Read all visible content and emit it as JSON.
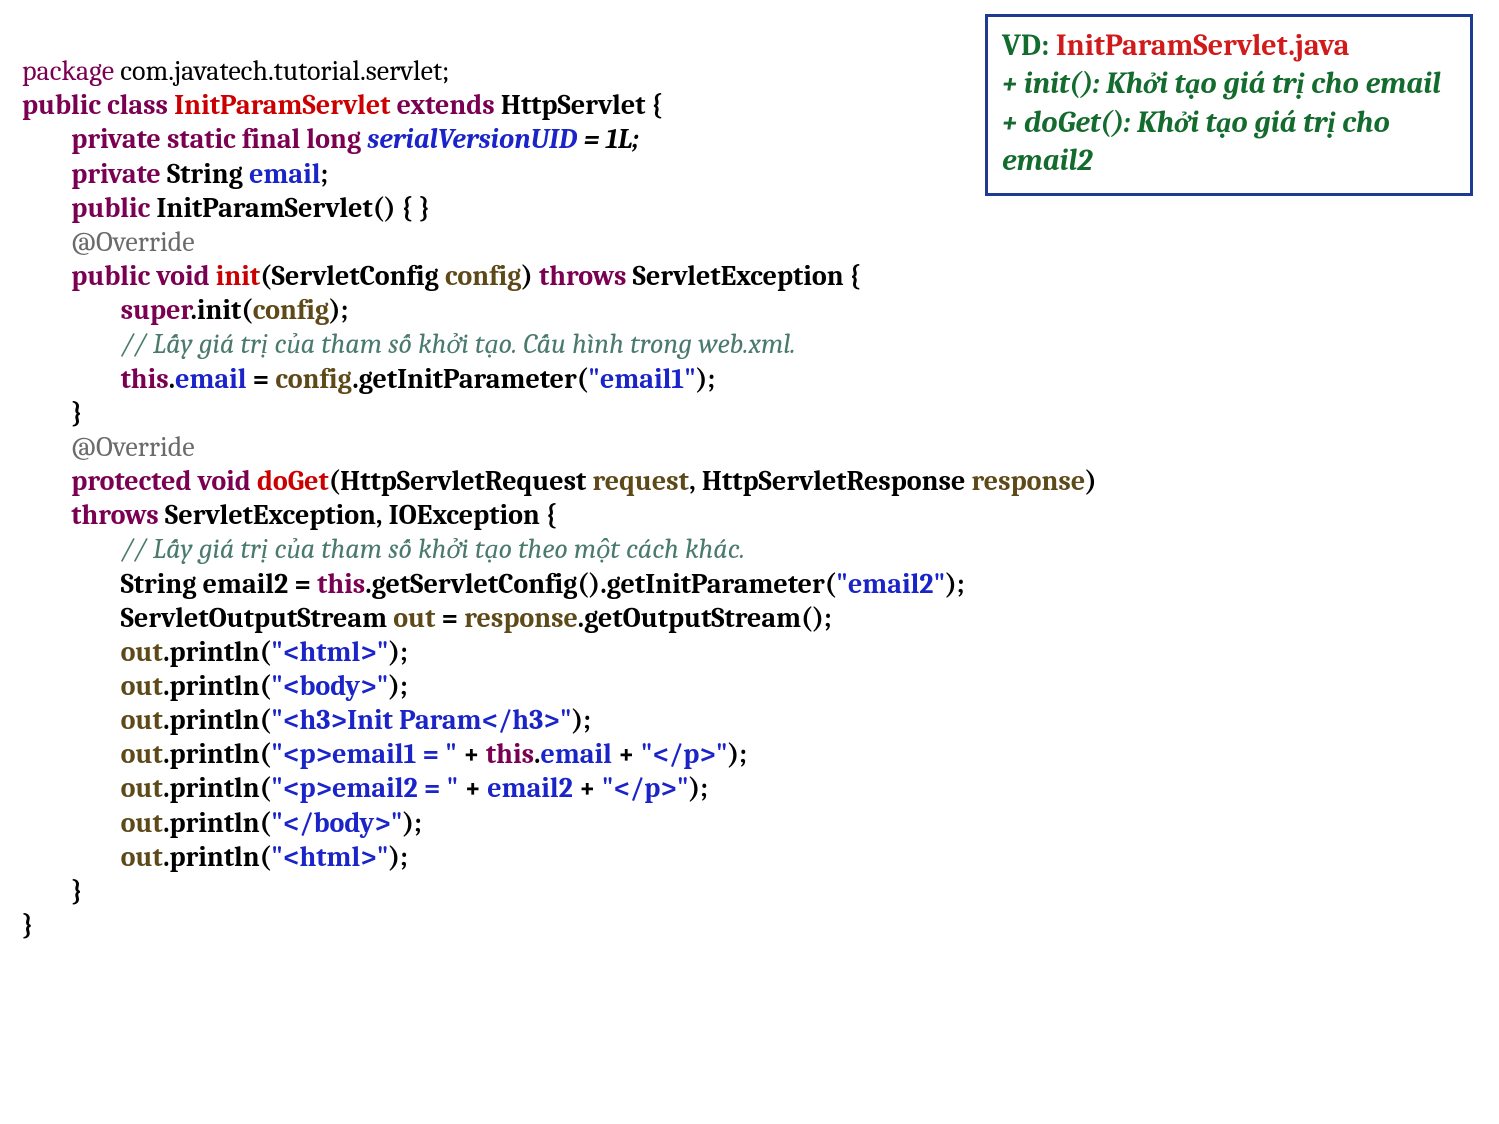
{
  "code": {
    "l01_package": "package",
    "l01_pkg": " com.javatech.tutorial.servlet;",
    "l02_public": "public",
    "l02_class": "class",
    "l02_name": "InitParamServlet",
    "l02_extends": "extends",
    "l02_super": "HttpServlet {",
    "l03_priv": "private",
    "l03_static": "static",
    "l03_final": "final",
    "l03_long": "long",
    "l03_field": "serialVersionUID",
    "l03_eq": " = 1L;",
    "l04_priv": "private",
    "l04_String": "String",
    "l04_email": "email",
    "l04_semi": ";",
    "l05_public": "public",
    "l05_ctor": "InitParamServlet() { }",
    "l06_anno": "@Override",
    "l07_public": "public",
    "l07_void": "void",
    "l07_init": "init",
    "l07_p1": "(ServletConfig ",
    "l07_cfg": "config",
    "l07_p2": ") ",
    "l07_throws": "throws",
    "l07_exc": " ServletException {",
    "l08_super": "super",
    "l08_dot": ".init(",
    "l08_cfg": "config",
    "l08_end": ");",
    "l09_comment": "// Lấy giá trị của tham số khởi tạo. Cấu hình trong web.xml.",
    "l10_this": "this",
    "l10_dot": ".",
    "l10_email": "email",
    "l10_eq": " = ",
    "l10_cfg": "config",
    "l10_get": ".getInitParameter(",
    "l10_str": "\"email1\"",
    "l10_end": ");",
    "l11_brace": "}",
    "l12_anno": "@Override",
    "l13_prot": "protected",
    "l13_void": "void",
    "l13_doget": "doGet",
    "l13_p1": "(HttpServletRequest ",
    "l13_req": "request",
    "l13_comma": ", HttpServletResponse ",
    "l13_res": "response",
    "l13_p2": ")",
    "l14_throws": "throws",
    "l14_rest": " ServletException, IOException {",
    "l15_comment": "// Lấy giá trị của tham số khởi tạo theo một cách khác.",
    "l16a": "String email2 = ",
    "l16this": "this",
    "l16b": ".getServletConfig().getInitParameter(",
    "l16str": "\"email2\"",
    "l16end": ");",
    "l17a": "ServletOutputStream ",
    "l17out": "out",
    "l17eq": " = ",
    "l17res": "response",
    "l17b": ".getOutputStream();",
    "l18out": "out",
    "l18a": ".println(",
    "l18str": "\"<html>\"",
    "l18end": ");",
    "l19out": "out",
    "l19a": ".println(",
    "l19str": "\"<body>\"",
    "l19end": ");",
    "l20out": "out",
    "l20a": ".println(",
    "l20str": "\"<h3>Init Param</h3>\"",
    "l20end": ");",
    "l21out": "out",
    "l21a": ".println(",
    "l21str1": "\"<p>email1 = \"",
    "l21plus1": " + ",
    "l21this": "this",
    "l21dot": ".",
    "l21email": "email",
    "l21plus2": " + ",
    "l21str2": "\"</p>\"",
    "l21end": ");",
    "l22out": "out",
    "l22a": ".println(",
    "l22str1": "\"<p>email2 = \"",
    "l22plus1": " + ",
    "l22e2": "email2",
    "l22plus2": " + ",
    "l22str2": "\"</p>\"",
    "l22end": ");",
    "l23out": "out",
    "l23a": ".println(",
    "l23str": "\"</body>\"",
    "l23end": ");",
    "l24out": "out",
    "l24a": ".println(",
    "l24str": "\"<html>\"",
    "l24end": ");",
    "l25_brace": "}",
    "l26_brace": "}"
  },
  "callout": {
    "vd": "VD:",
    "file": "InitParamServlet.java",
    "line1": "+ init(): Khởi tạo giá trị cho email",
    "line2": "+ doGet(): Khởi tạo giá trị cho email2"
  },
  "indent": {
    "i0": "",
    "i1": "        ",
    "i2": "                "
  }
}
